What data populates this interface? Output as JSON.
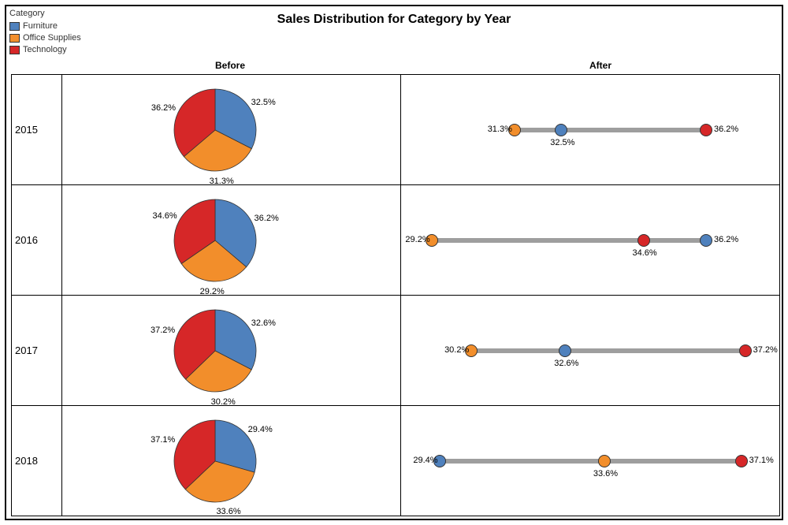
{
  "title": "Sales Distribution for Category by Year",
  "legend": {
    "title": "Category",
    "items": [
      {
        "name": "Furniture",
        "color": "#4f81bd"
      },
      {
        "name": "Office Supplies",
        "color": "#f28e2b"
      },
      {
        "name": "Technology",
        "color": "#d62728"
      }
    ]
  },
  "columns": {
    "before": "Before",
    "after": "After"
  },
  "years": [
    "2015",
    "2016",
    "2017",
    "2018"
  ],
  "chart_data": {
    "type": "pie",
    "note": "Each year shows a pie (Before) and a dot-strip (After) of the same percentages. Categories map to legend order: Furniture, Office Supplies, Technology.",
    "series_names": [
      "Furniture",
      "Office Supplies",
      "Technology"
    ],
    "rows": [
      {
        "year": "2015",
        "values": [
          32.5,
          31.3,
          36.2
        ]
      },
      {
        "year": "2016",
        "values": [
          36.2,
          29.2,
          34.6
        ]
      },
      {
        "year": "2017",
        "values": [
          32.6,
          30.2,
          37.2
        ]
      },
      {
        "year": "2018",
        "values": [
          29.4,
          33.6,
          37.1
        ]
      }
    ],
    "after_axis_range": [
      29,
      37.5
    ]
  }
}
